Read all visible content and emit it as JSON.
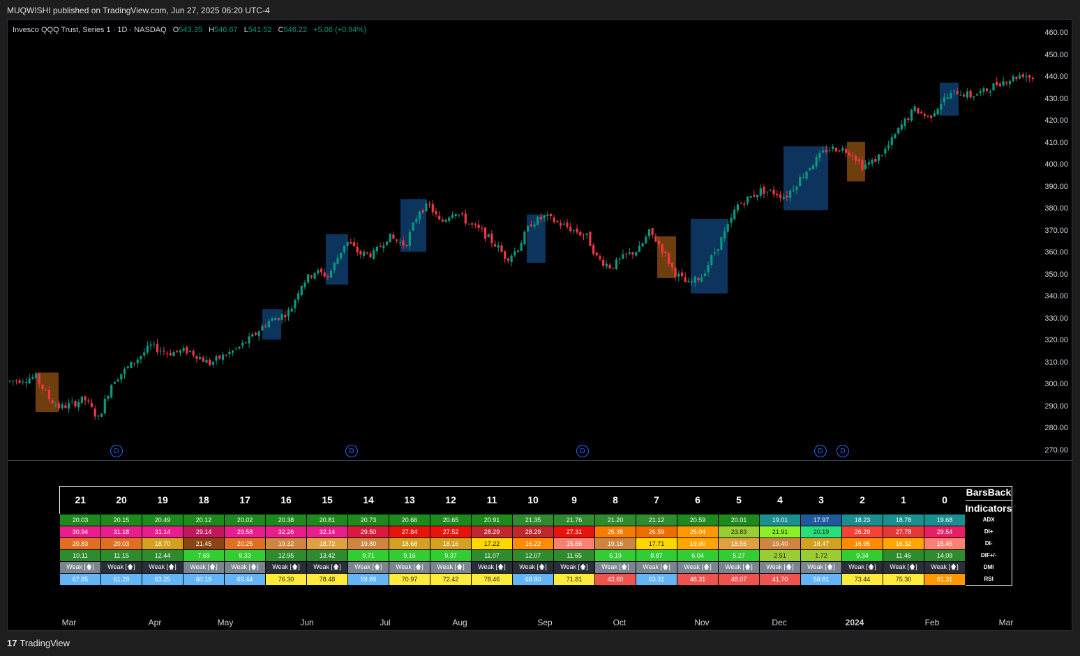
{
  "header": {
    "publisher": "MUQWISHI published on TradingView.com, Jun 27, 2025 06:20 UTC-4"
  },
  "legend": {
    "symbol": "Invesco QQQ Trust, Series 1 · 1D · NASDAQ",
    "o_label": "O",
    "o": "543.35",
    "h_label": "H",
    "h": "546.67",
    "l_label": "L",
    "l": "541.52",
    "c_label": "C",
    "c": "546.22",
    "change": "+5.06 (+0.94%)"
  },
  "colors": {
    "up": "#089981",
    "down": "#f23645",
    "blue_box": "#0d3a66",
    "orange_box": "#7a4510",
    "d_marker": "#2962ff"
  },
  "y_axis": [
    "460.00",
    "450.00",
    "440.00",
    "430.00",
    "420.00",
    "410.00",
    "400.00",
    "390.00",
    "380.00",
    "370.00",
    "360.00",
    "350.00",
    "340.00",
    "330.00",
    "320.00",
    "310.00",
    "300.00",
    "290.00",
    "280.00",
    "270.00"
  ],
  "x_axis": [
    "Mar",
    "Apr",
    "May",
    "Jun",
    "Jul",
    "Aug",
    "Sep",
    "Oct",
    "Nov",
    "Dec",
    "2024",
    "Feb",
    "Mar"
  ],
  "d_markers": [
    "D",
    "D",
    "D",
    "D",
    "D"
  ],
  "table": {
    "barsback_label": "BarsBack",
    "indicators_label": "Indicators",
    "barsback": [
      "21",
      "20",
      "19",
      "18",
      "17",
      "16",
      "15",
      "14",
      "13",
      "12",
      "11",
      "10",
      "9",
      "8",
      "7",
      "6",
      "5",
      "4",
      "3",
      "2",
      "1",
      "0"
    ],
    "rows": [
      {
        "label": "ADX",
        "values": [
          "20.03",
          "20.15",
          "20.49",
          "20.12",
          "20.02",
          "20.38",
          "20.81",
          "20.73",
          "20.66",
          "20.65",
          "20.91",
          "21.35",
          "21.76",
          "21.20",
          "21.12",
          "20.59",
          "20.01",
          "19.01",
          "17.97",
          "18.23",
          "18.78",
          "19.68"
        ],
        "colors": [
          "#1e8a1e",
          "#1e8a1e",
          "#1e8a1e",
          "#1e8a1e",
          "#1e8a1e",
          "#1e8a1e",
          "#1e8a1e",
          "#1e8a1e",
          "#1e8a1e",
          "#1e8a1e",
          "#1e8a1e",
          "#2e8b2e",
          "#2e8b2e",
          "#2e8b2e",
          "#2e8b2e",
          "#1e8a1e",
          "#1e8a1e",
          "#1a8f8f",
          "#1f5b9c",
          "#1a8f8f",
          "#1a8f8f",
          "#1a8f8f"
        ]
      },
      {
        "label": "DI+",
        "values": [
          "30.94",
          "31.18",
          "31.14",
          "29.14",
          "29.58",
          "32.26",
          "32.14",
          "29.50",
          "27.84",
          "27.52",
          "28.29",
          "28.29",
          "27.31",
          "25.35",
          "26.59",
          "25.04",
          "23.83",
          "21.91",
          "20.19",
          "26.29",
          "27.78",
          "29.54"
        ],
        "colors": [
          "#e91e8c",
          "#e91e8c",
          "#e91e8c",
          "#c2185b",
          "#e91e8c",
          "#e91e8c",
          "#e91e8c",
          "#d81b3c",
          "#e8140c",
          "#e8140c",
          "#c0282d",
          "#c0282d",
          "#e8140c",
          "#f57c00",
          "#ef6c00",
          "#ff9800",
          "#9acd32",
          "#8bf028",
          "#28e07a",
          "#f44336",
          "#e53935",
          "#e91e63"
        ]
      },
      {
        "label": "DI-",
        "values": [
          "20.83",
          "20.03",
          "18.70",
          "21.45",
          "20.25",
          "19.32",
          "18.72",
          "19.80",
          "18.68",
          "18.16",
          "17.22",
          "16.22",
          "15.66",
          "19.16",
          "17.71",
          "19.00",
          "18.56",
          "19.40",
          "18.47",
          "16.95",
          "16.32",
          "15.45"
        ],
        "colors": [
          "#e07020",
          "#e07020",
          "#d4a020",
          "#8b4513",
          "#e07020",
          "#cd853f",
          "#e0a040",
          "#cd853f",
          "#d4a020",
          "#d4a020",
          "#ffd700",
          "#ff8c00",
          "#fa8072",
          "#cd853f",
          "#ffd700",
          "#ffa500",
          "#e0a040",
          "#cd853f",
          "#d4a020",
          "#ff8c00",
          "#ffa500",
          "#fa8072"
        ]
      },
      {
        "label": "DIF+/-",
        "values": [
          "10.11",
          "11.15",
          "12.44",
          "7.69",
          "9.33",
          "12.95",
          "13.42",
          "9.71",
          "9.16",
          "9.37",
          "11.07",
          "12.07",
          "11.65",
          "6.19",
          "8.87",
          "6.04",
          "5.27",
          "2.51",
          "1.72",
          "9.34",
          "11.46",
          "14.09"
        ],
        "colors": [
          "#2e8b2e",
          "#2e8b2e",
          "#2e8b2e",
          "#32cd32",
          "#32cd32",
          "#2e8b2e",
          "#2e8b2e",
          "#32cd32",
          "#32cd32",
          "#32cd32",
          "#2e8b2e",
          "#2e8b2e",
          "#2e8b2e",
          "#32cd32",
          "#32cd32",
          "#32cd32",
          "#32cd32",
          "#9acd32",
          "#9acd32",
          "#32cd32",
          "#2e8b2e",
          "#2e8b2e"
        ]
      },
      {
        "label": "DMI",
        "values": [
          "Weak [🡅]",
          "Weak [🡅]",
          "Weak [🡅]",
          "Weak [🡅]",
          "Weak [🡅]",
          "Weak [🡅]",
          "Weak [🡅]",
          "Weak [🡅]",
          "Weak [🡅]",
          "Weak [🡅]",
          "Weak [🡅]",
          "Weak [🡅]",
          "Weak [🡅]",
          "Weak [🡅]",
          "Weak [🡅]",
          "Weak [🡅]",
          "Weak [🡅]",
          "Weak [🡅]",
          "Weak [🡅]",
          "Weak [🡅]",
          "Weak [🡅]",
          "Weak [🡅]"
        ],
        "colors": [
          "#7b8490",
          "#2a2e39",
          "#2a2e39",
          "#7b8490",
          "#7b8490",
          "#2a2e39",
          "#2a2e39",
          "#7b8490",
          "#7b8490",
          "#7b8490",
          "#2a2e39",
          "#2a2e39",
          "#2a2e39",
          "#7b8490",
          "#7b8490",
          "#7b8490",
          "#7b8490",
          "#7b8490",
          "#7b8490",
          "#2a2e39",
          "#2a2e39",
          "#2a2e39"
        ]
      },
      {
        "label": "RSI",
        "values": [
          "67.85",
          "61.29",
          "63.25",
          "60.19",
          "69.44",
          "76.30",
          "78.48",
          "59.89",
          "70.97",
          "72.42",
          "78.46",
          "68.80",
          "71.81",
          "43.60",
          "63.31",
          "48.31",
          "48.07",
          "41.70",
          "58.81",
          "73.44",
          "75.30",
          "81.31"
        ],
        "colors": [
          "#64b5f6",
          "#64b5f6",
          "#64b5f6",
          "#64b5f6",
          "#64b5f6",
          "#ffeb3b",
          "#ffeb3b",
          "#64b5f6",
          "#ffeb3b",
          "#ffeb3b",
          "#ffeb3b",
          "#64b5f6",
          "#ffeb3b",
          "#ef5350",
          "#64b5f6",
          "#ef5350",
          "#ef5350",
          "#ef5350",
          "#64b5f6",
          "#ffeb3b",
          "#ffeb3b",
          "#ff9800"
        ]
      }
    ]
  },
  "footer": {
    "brand": "TradingView",
    "logo_glyph": "17"
  }
}
